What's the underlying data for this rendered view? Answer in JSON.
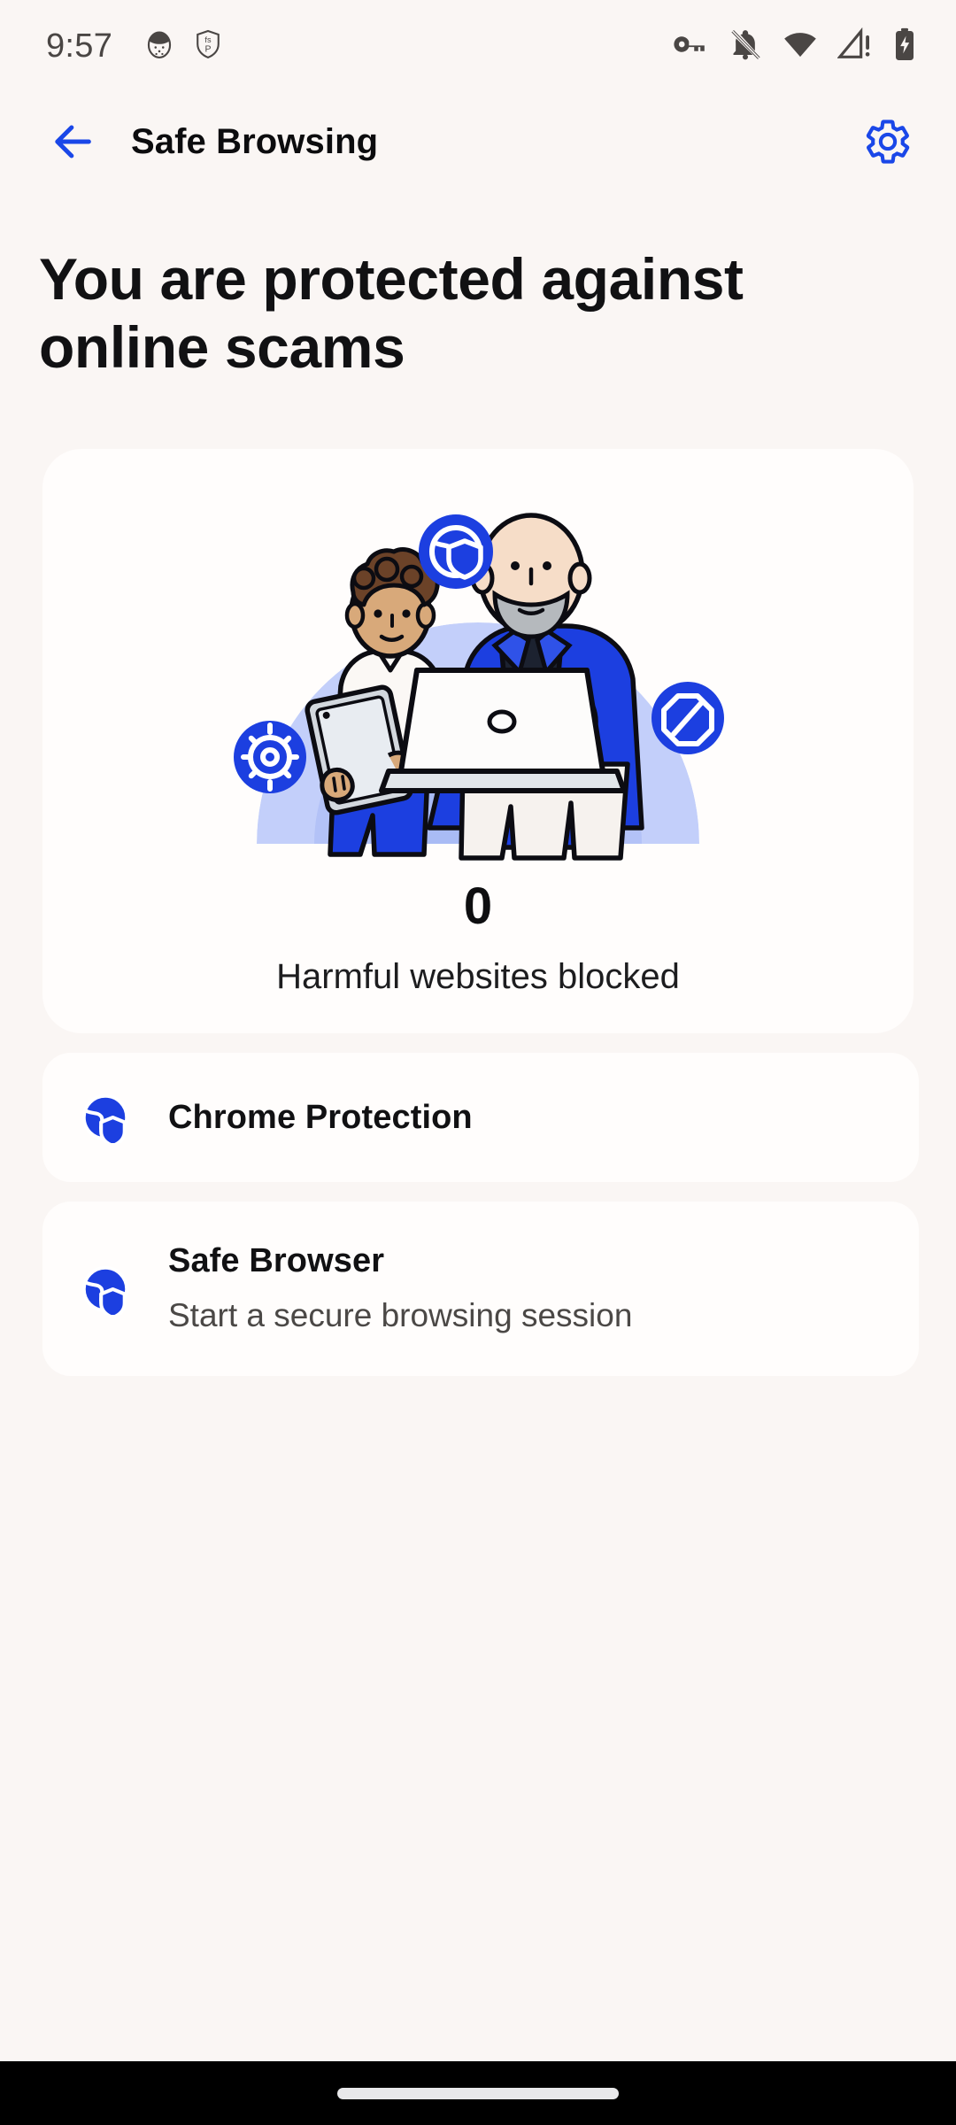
{
  "status_bar": {
    "time": "9:57",
    "left_icons": [
      "face-notification-icon",
      "shield-fsp-icon"
    ],
    "right_icons": [
      "vpn-key-icon",
      "notifications-muted-icon",
      "wifi-icon",
      "cellular-signal-warning-icon",
      "battery-charging-icon"
    ]
  },
  "app_bar": {
    "back_icon": "arrow-back-icon",
    "title": "Safe Browsing",
    "settings_icon": "gear-icon"
  },
  "headline": "You are protected against online scams",
  "hero": {
    "illustration": "people-with-laptop-illustration",
    "badges": [
      "globe-shield-icon",
      "gear-icon",
      "block-octagon-icon"
    ],
    "count": "0",
    "caption": "Harmful websites blocked"
  },
  "rows": [
    {
      "icon": "globe-shield-icon",
      "title": "Chrome Protection",
      "subtitle": ""
    },
    {
      "icon": "globe-shield-icon",
      "title": "Safe Browser",
      "subtitle": "Start a secure browsing session"
    }
  ],
  "colors": {
    "background": "#faf6f4",
    "card": "#fffdfc",
    "accent_blue": "#1a47e8",
    "text_primary": "#111113",
    "text_secondary": "#4b4846",
    "nav_bar": "#000000"
  },
  "nav_bar": {
    "home_indicator": "home-indicator-pill"
  }
}
